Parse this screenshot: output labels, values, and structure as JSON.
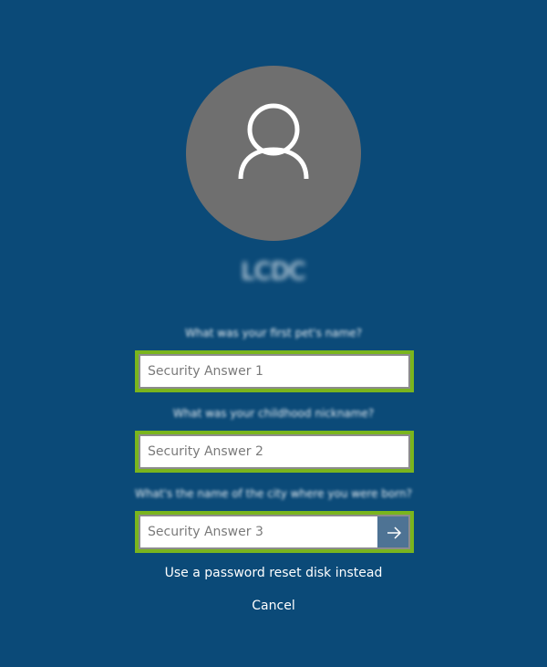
{
  "user": {
    "name": "LCDC",
    "avatar_icon": "user-icon",
    "avatar_color": "#6f6f6f"
  },
  "security": {
    "question_1": "What was your first pet's name?",
    "question_2": "What was your childhood nickname?",
    "question_3": "What's the name of the city where you were born?",
    "answer_1_placeholder": "Security Answer 1",
    "answer_2_placeholder": "Security Answer 2",
    "answer_3_placeholder": "Security Answer 3",
    "submit_icon": "arrow-right-icon"
  },
  "links": {
    "reset_disk": "Use a password reset disk instead",
    "cancel": "Cancel"
  },
  "colors": {
    "background": "#0b4a78",
    "highlight": "#7ab51d",
    "submit_button": "#4e7394"
  }
}
